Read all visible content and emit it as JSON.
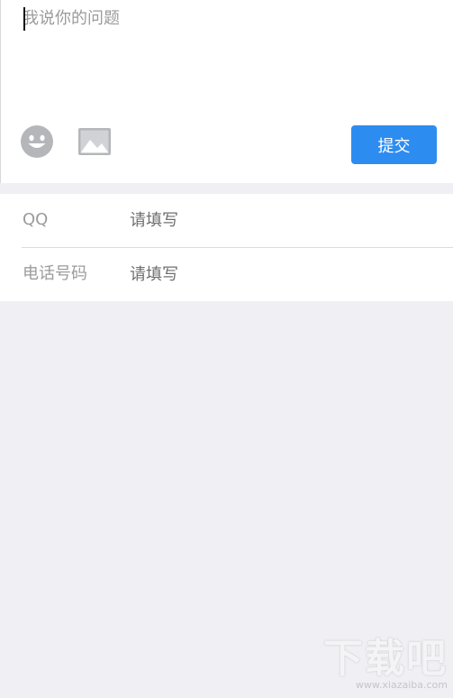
{
  "compose": {
    "placeholder": "我说你的问题",
    "submit_label": "提交",
    "icons": [
      "emoji-icon",
      "image-icon"
    ]
  },
  "contact": {
    "fields": [
      {
        "label": "QQ",
        "placeholder": "请填写"
      },
      {
        "label": "电话号码",
        "placeholder": "请填写"
      }
    ]
  },
  "watermark": {
    "logo": "下载吧",
    "url": "www.xiazaiba.com"
  },
  "colors": {
    "accent": "#2d8cf0",
    "background": "#efeff4",
    "icon_gray": "#b4b6ba"
  }
}
